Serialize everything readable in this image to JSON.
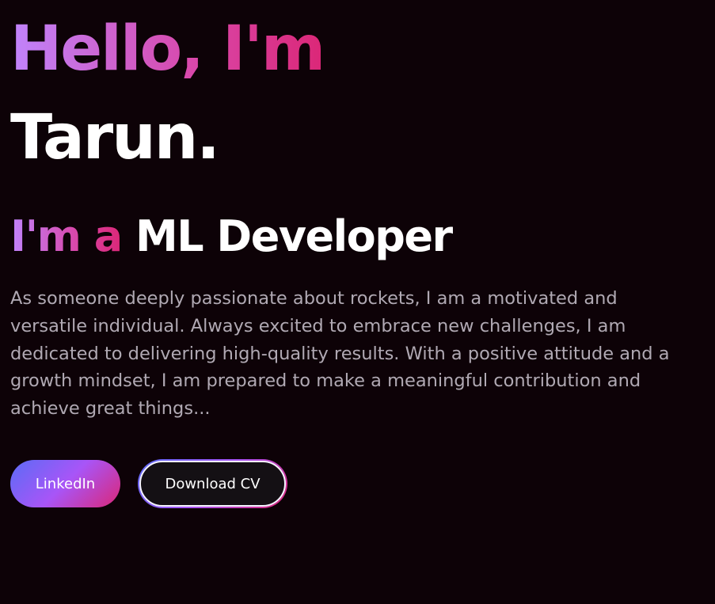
{
  "hero": {
    "greeting": "Hello, I'm",
    "name": "Tarun.",
    "role_prefix": "I'm a",
    "role_title": "ML Developer",
    "bio": "As someone deeply passionate about rockets, I am a motivated and versatile individual. Always excited to embrace new challenges, I am dedicated to delivering high-quality results. With a positive attitude and a growth mindset, I am prepared to make a meaningful contribution and achieve great things..."
  },
  "actions": {
    "linkedin_label": "LinkedIn",
    "download_cv_label": "Download CV"
  },
  "colors": {
    "background": "#0d0207",
    "gradient_start": "#c084fc",
    "gradient_end": "#db2777",
    "button_gradient_start": "#5b6cf6",
    "bio_text": "#b0a9b3"
  }
}
